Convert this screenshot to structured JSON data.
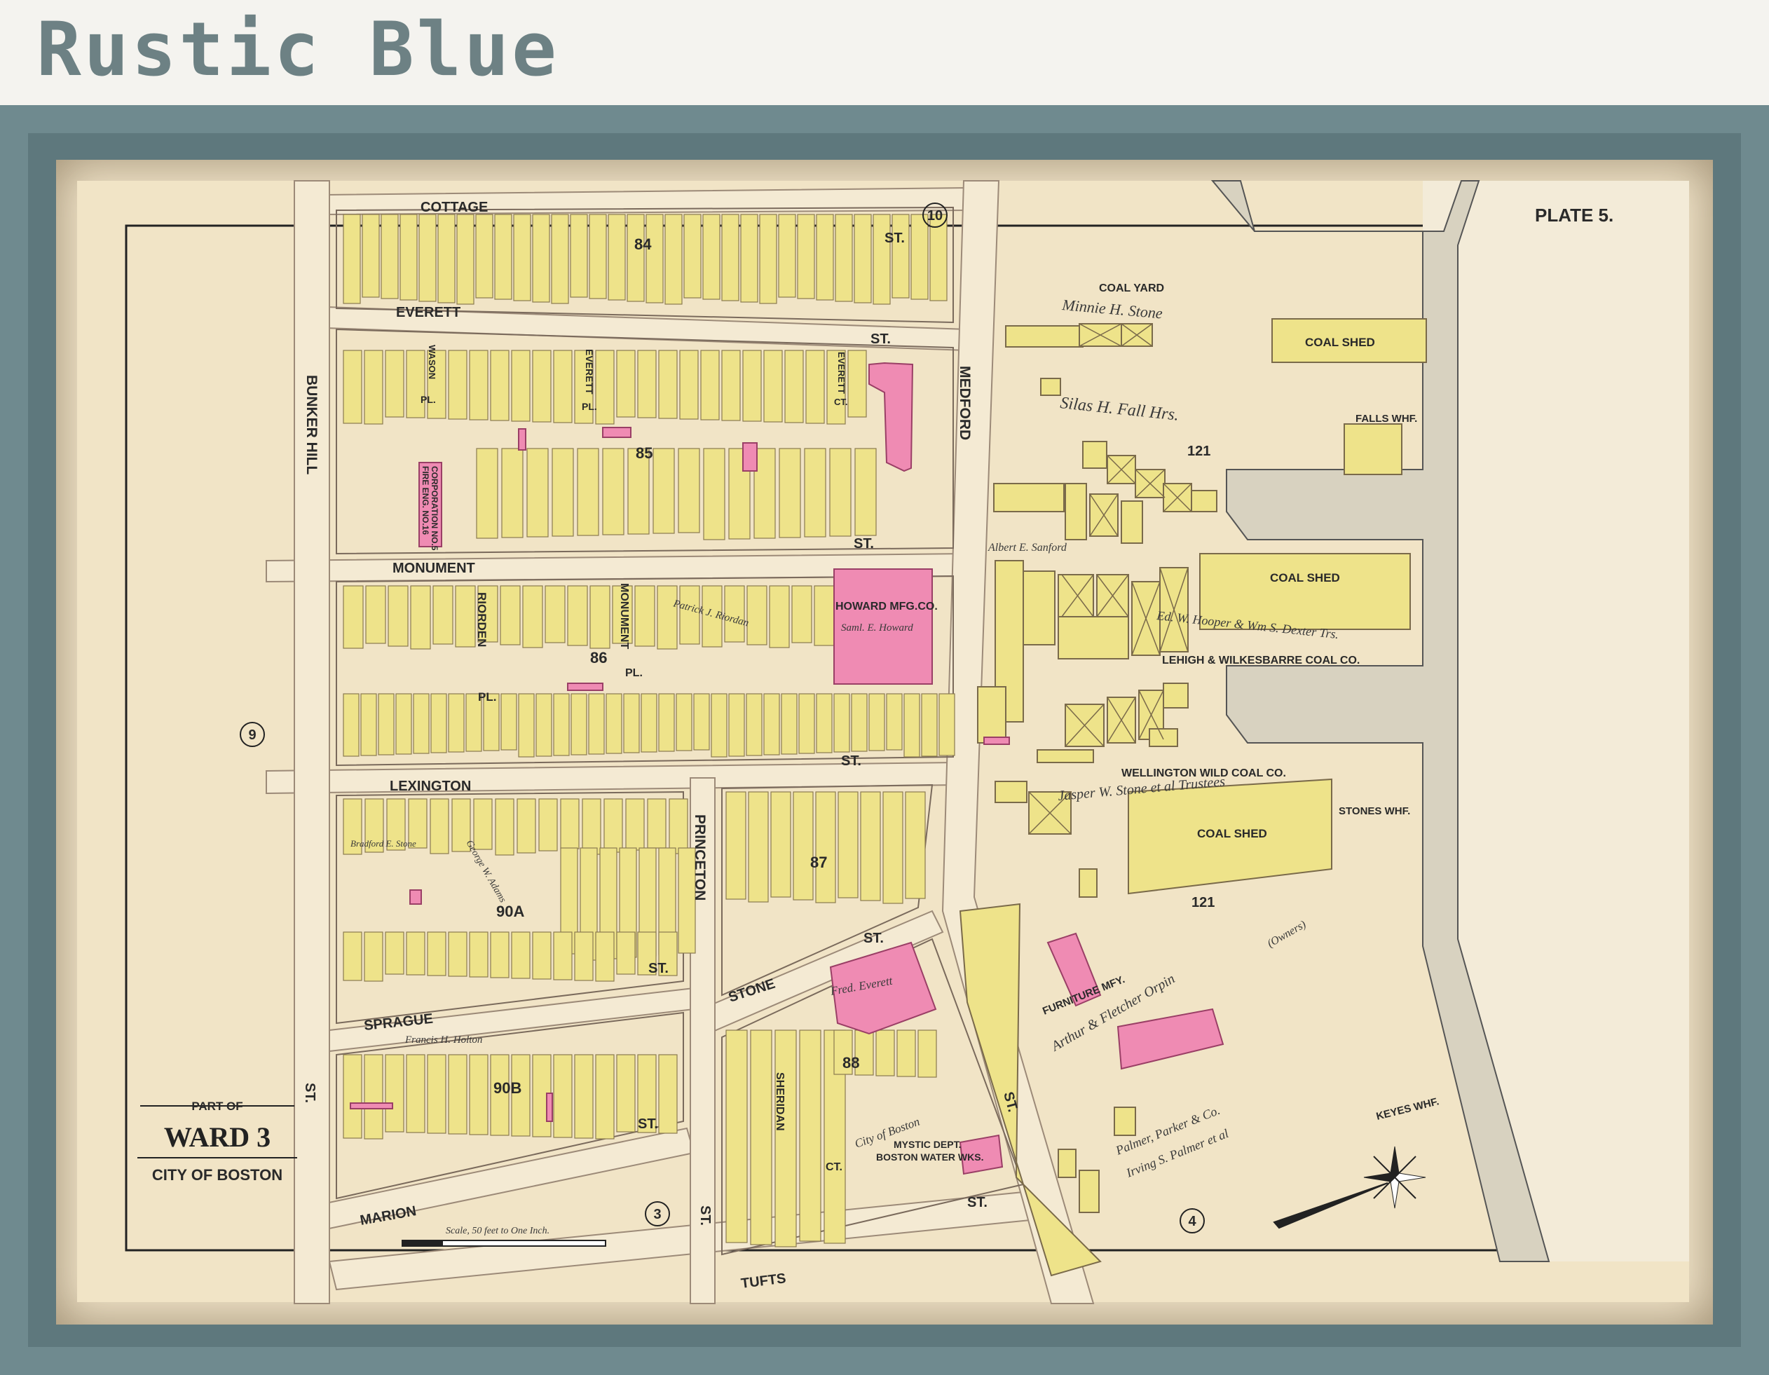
{
  "brand": {
    "title": "Rustic Blue"
  },
  "plate": {
    "label": "PLATE 5."
  },
  "cartouche": {
    "part_of": "PART OF",
    "ward": "WARD 3",
    "city": "CITY OF BOSTON"
  },
  "scale": {
    "text": "Scale, 50 feet to One Inch."
  },
  "streets": {
    "cottage": "COTTAGE",
    "cottage_st": "ST.",
    "everett": "EVERETT",
    "everett_st": "ST.",
    "monument": "MONUMENT",
    "monument_st": "ST.",
    "lexington": "LEXINGTON",
    "lexington_st": "ST.",
    "sprague": "SPRAGUE",
    "sprague_st": "ST.",
    "marion": "MARION",
    "marion_st": "ST.",
    "tufts": "TUFTS",
    "tufts_st": "ST.",
    "stone": "STONE",
    "stone_st": "ST.",
    "bunker_hill": "BUNKER HILL",
    "bunker_hill_st": "ST.",
    "medford": "MEDFORD",
    "medford_st": "ST.",
    "princeton": "PRINCETON",
    "princeton_st": "ST.",
    "sheridan": "SHERIDAN",
    "riorden": "RIORDEN",
    "riorden_pl": "PL.",
    "monument_pl": "MONUMENT",
    "monument_pl_pl": "PL.",
    "wason": "WASON",
    "wason_pl": "PL.",
    "everett_pl": "EVERETT",
    "everett_pl_pl": "PL.",
    "everett_ct": "EVERETT",
    "everett_ct_ct": "CT.",
    "sheridan_ct": "CT."
  },
  "blocks": {
    "b84": "84",
    "b85": "85",
    "b86": "86",
    "b87": "87",
    "b88": "88",
    "b90a": "90A",
    "b90b": "90B",
    "b121a": "121",
    "b121b": "121"
  },
  "plates": {
    "p10": "10",
    "p9": "9",
    "p3": "3",
    "p4": "4"
  },
  "labels": {
    "coal_yard": "COAL YARD",
    "coal_shed_1": "COAL SHED",
    "coal_shed_2": "COAL SHED",
    "coal_shed_3": "COAL SHED",
    "falls_whf": "FALLS WHF.",
    "stones_whf": "STONES WHF.",
    "keyes_whf": "KEYES WHF.",
    "lehigh": "LEHIGH & WILKESBARRE COAL CO.",
    "wellington": "WELLINGTON WILD COAL CO.",
    "howard": "HOWARD MFG.CO.",
    "furniture": "FURNITURE MFY.",
    "mystic_1": "MYSTIC DEPT.",
    "mystic_2": "BOSTON WATER WKS.",
    "fire_eng": "FIRE ENG. NO.16",
    "fire_eng_2": "CORPORATION NO.5"
  },
  "owners": {
    "minnie": "Minnie H. Stone",
    "silas": "Silas H. Fall Hrs.",
    "albert": "Albert E. Sanford",
    "hooper": "Ed. W. Hooper & Wm S. Dexter Trs.",
    "jasper": "Jasper W. Stone et al Trustees",
    "orpin": "Arthur & Fletcher Orpin",
    "orpin_2": "(Owners)",
    "palmer": "Palmer, Parker & Co.",
    "irving": "Irving S. Palmer et al",
    "fred": "Fred. Everett",
    "patrick": "Patrick J. Riordan",
    "samuel": "Saml. E. Howard",
    "george": "George W. Adams",
    "francis": "Francis H. Holton",
    "bradford": "Bradford E. Stone",
    "city_boston": "City of Boston"
  },
  "colors": {
    "frame": "#6f8a8f",
    "paper": "#efe2c7",
    "building_yellow": "#eee38a",
    "building_pink": "#ef8bb3",
    "street": "#f3e9d2"
  }
}
